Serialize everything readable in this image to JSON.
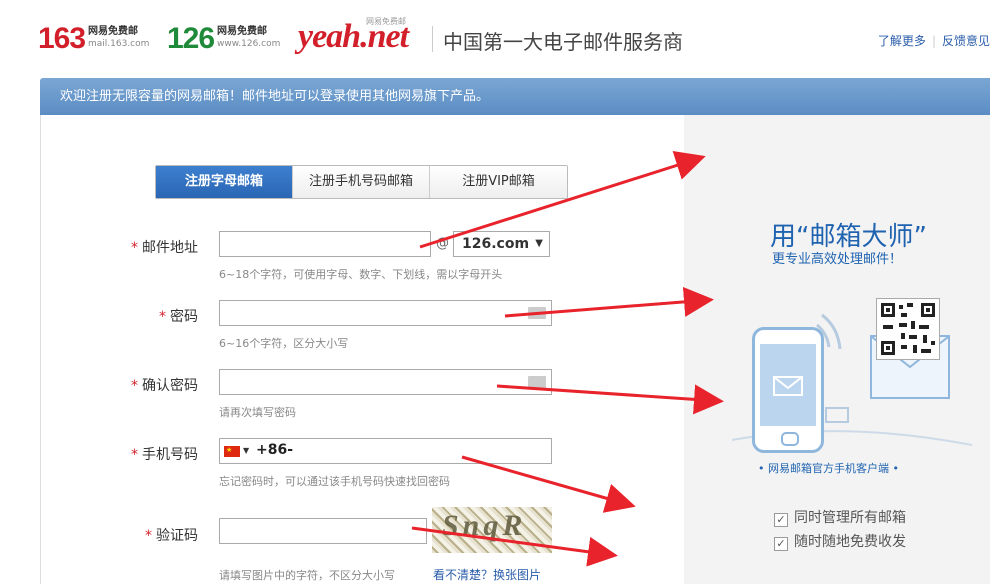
{
  "header": {
    "logo_163": {
      "num": "163",
      "name": "网易免费邮",
      "domain": "mail.163.com"
    },
    "logo_126": {
      "num": "126",
      "name": "网易免费邮",
      "domain": "www.126.com"
    },
    "logo_yeah": {
      "text": "yeah.net",
      "tag": "网易免费邮"
    },
    "tagline": "中国第一大电子邮件服务商",
    "links": [
      "了解更多",
      "反馈意见"
    ]
  },
  "banner": "欢迎注册无限容量的网易邮箱！邮件地址可以登录使用其他网易旗下产品。",
  "tabs": [
    {
      "label": "注册字母邮箱",
      "active": true
    },
    {
      "label": "注册手机号码邮箱",
      "active": false
    },
    {
      "label": "注册VIP邮箱",
      "active": false
    }
  ],
  "form": {
    "required_mark": "*",
    "email": {
      "label": "邮件地址",
      "value": "",
      "at": "@",
      "domain": "126.com",
      "hint": "6~18个字符，可使用字母、数字、下划线，需以字母开头"
    },
    "password": {
      "label": "密码",
      "value": "",
      "hint": "6~16个字符，区分大小写"
    },
    "confirm": {
      "label": "确认密码",
      "value": "",
      "hint": "请再次填写密码"
    },
    "phone": {
      "label": "手机号码",
      "prefix": "+86-",
      "value": "",
      "hint": "忘记密码时，可以通过该手机号码快速找回密码"
    },
    "captcha": {
      "label": "验证码",
      "value": "",
      "image_text": "SnqR",
      "hint": "请填写图片中的字符，不区分大小写",
      "refresh_link": "看不清楚？换张图片"
    }
  },
  "promo": {
    "title": "用“邮箱大师”",
    "subtitle": "更专业高效处理邮件！",
    "caption": "• 网易邮箱官方手机客户端 •",
    "features": [
      "同时管理所有邮箱",
      "随时随地免费收发"
    ]
  },
  "colors": {
    "accent": "#2a66b4",
    "brand_red": "#d21f2a",
    "brand_green": "#1f8a3a",
    "arrow": "#e8232b"
  }
}
